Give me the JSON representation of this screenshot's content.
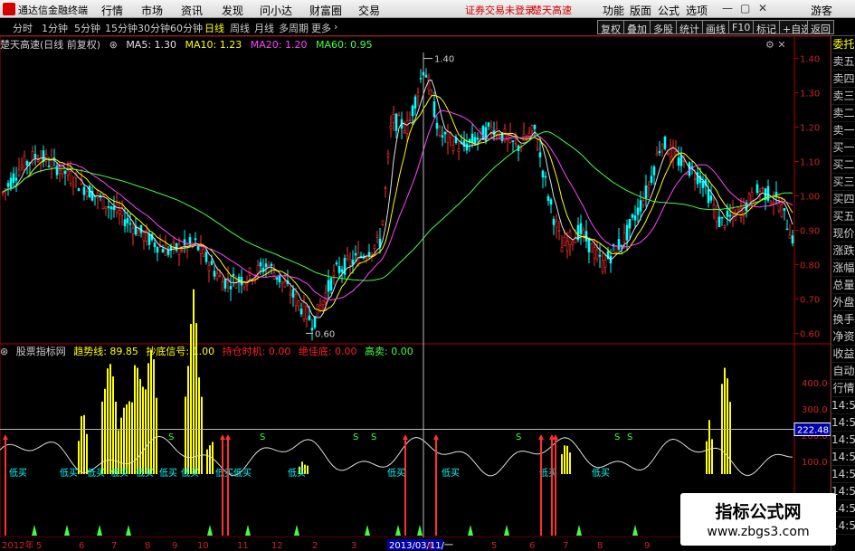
{
  "menubar": {
    "app_name": "通达信金融终端",
    "menus": [
      "行情",
      "市场",
      "资讯",
      "发现",
      "问小达",
      "财富圈",
      "交易"
    ],
    "notices": [
      "证券交易未登录",
      "楚天高速"
    ],
    "right_items": [
      "功能",
      "版面",
      "公式",
      "选项"
    ],
    "user": "游客"
  },
  "toolbar": {
    "periods": [
      "分时",
      "1分钟",
      "5分钟",
      "15分钟",
      "30分钟",
      "60分钟",
      "日线",
      "周线",
      "月线",
      "多周期",
      "更多"
    ],
    "active_period": "日线",
    "right_buttons": [
      "复权",
      "叠加",
      "多股",
      "统计",
      "画线",
      "F10",
      "标记",
      "+自选",
      "返回"
    ]
  },
  "main_chart": {
    "title": "楚天高速(日线 前复权)",
    "indicators": [
      {
        "label": "MA5: 1.30",
        "color": "#e0e0e0"
      },
      {
        "label": "MA10: 1.23",
        "color": "#ffff00"
      },
      {
        "label": "MA20: 1.20",
        "color": "#ff44ff"
      },
      {
        "label": "MA60: 0.95",
        "color": "#44ff44"
      }
    ],
    "y_ticks": [
      "1.40",
      "1.30",
      "1.20",
      "1.10",
      "1.00",
      "0.90",
      "0.80",
      "0.70",
      "0.60"
    ],
    "high_label": "1.40",
    "low_label": "0.60"
  },
  "sub_chart": {
    "title": "股票指标网",
    "indicators": [
      {
        "label": "趋势线: 89.85",
        "color": "#ffff00"
      },
      {
        "label": "抄底信号: 1.00",
        "color": "#ffff00"
      },
      {
        "label": "持仓时机: 0.00",
        "color": "#ff2020"
      },
      {
        "label": "绝佳底: 0.00",
        "color": "#ff2020"
      },
      {
        "label": "高卖: 0.00",
        "color": "#40ff40"
      }
    ],
    "y_ticks": [
      "400.0",
      "300.0",
      "222.48",
      "200.0",
      "100.0"
    ],
    "cursor_value": "222.48",
    "signal_labels": [
      "低买",
      "S",
      "高卖"
    ]
  },
  "x_axis": {
    "labels": [
      "2012年",
      "5",
      "6",
      "7",
      "8",
      "9",
      "10",
      "11",
      "12",
      "2",
      "3",
      "2013/03/11/一",
      "4",
      "5",
      "6",
      "7",
      "8",
      "9"
    ]
  },
  "sidebar": {
    "items": [
      "委托",
      "卖五",
      "卖四",
      "卖三",
      "卖二",
      "卖一",
      "买一",
      "买二",
      "买三",
      "买四",
      "买五",
      "现价",
      "涨跌",
      "涨幅",
      "总量",
      "外盘",
      "换手",
      "净资",
      "收益",
      "自动",
      "行情",
      "14:50",
      "14:50",
      "14:50",
      "14:50",
      "14:50",
      "14:50",
      "14:50",
      "14:50"
    ]
  },
  "watermark": {
    "line1": "指标公式网",
    "line2": "www.zbgs3.com"
  },
  "colors": {
    "up": "#ff3030",
    "down": "#00ffff",
    "ma5": "#e0e0e0",
    "ma10": "#ffff00",
    "ma20": "#ff44ff",
    "ma60": "#44ff44",
    "bars": "#ffff00",
    "axis": "#b00000"
  }
}
